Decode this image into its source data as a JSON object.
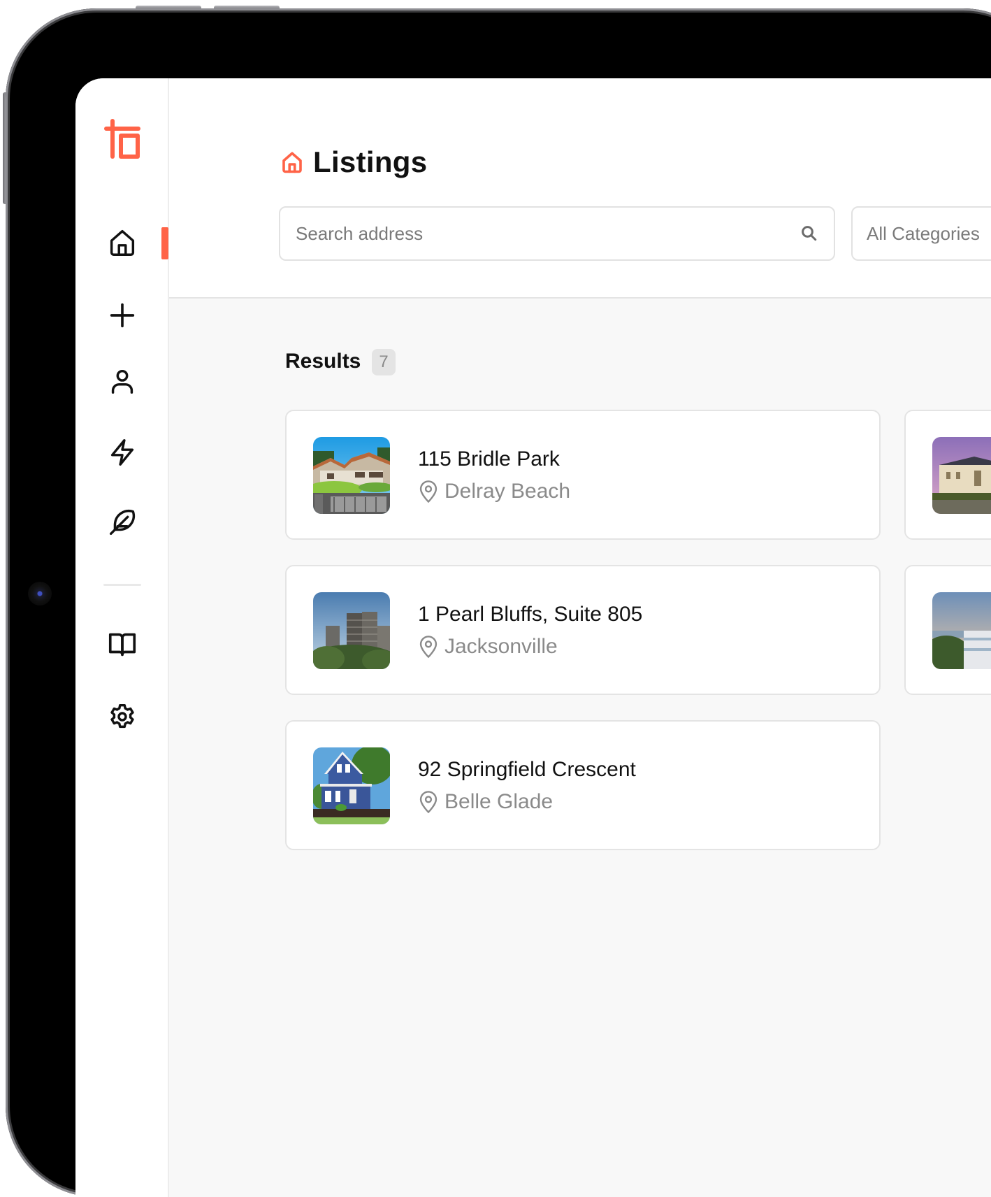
{
  "app": {
    "brand_color": "#ff6347",
    "logo_icon": "brand-logo"
  },
  "sidebar": {
    "items": [
      {
        "id": "home",
        "icon": "home-icon",
        "active": true
      },
      {
        "id": "add",
        "icon": "plus-icon",
        "active": false
      },
      {
        "id": "profile",
        "icon": "user-icon",
        "active": false
      },
      {
        "id": "activity",
        "icon": "lightning-icon",
        "active": false
      },
      {
        "id": "feather",
        "icon": "feather-icon",
        "active": false
      }
    ],
    "bottom_items": [
      {
        "id": "docs",
        "icon": "book-icon"
      },
      {
        "id": "settings",
        "icon": "gear-icon"
      }
    ]
  },
  "header": {
    "title": "Listings",
    "title_icon": "home-icon",
    "search": {
      "placeholder": "Search address",
      "value": "",
      "icon": "search-icon"
    },
    "category_select": {
      "selected": "All Categories"
    }
  },
  "results": {
    "label": "Results",
    "count": "7",
    "listings": [
      {
        "address": "115 Bridle Park",
        "city": "Delray Beach",
        "image": "house-photo"
      },
      {
        "address": "1 Pearl Bluffs, Suite 805",
        "city": "Jacksonville",
        "image": "apartment-towers-photo"
      },
      {
        "address": "92 Springfield Crescent",
        "city": "Belle Glade",
        "image": "blue-house-photo"
      }
    ],
    "partial_listings": [
      {
        "image": "mansion-photo"
      },
      {
        "image": "waterfront-building-photo"
      }
    ]
  }
}
